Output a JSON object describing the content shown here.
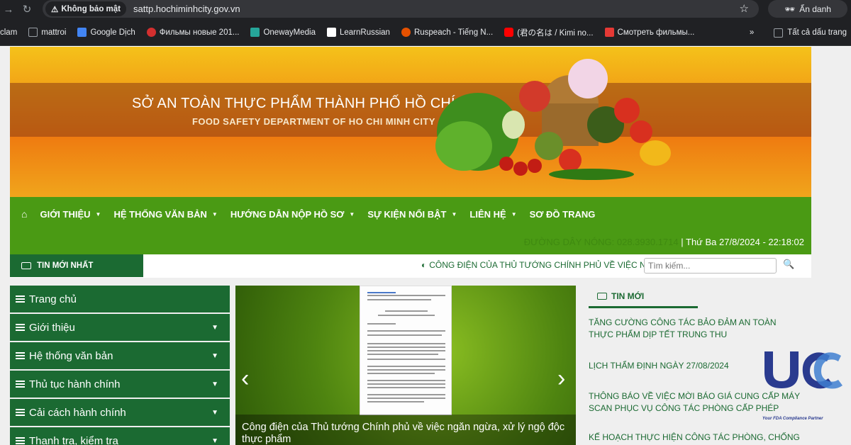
{
  "browser": {
    "security_label": "Không bảo mật",
    "url": "sattp.hochiminhcity.gov.vn",
    "incognito_label": "Ẩn danh"
  },
  "bookmarks": {
    "items": [
      {
        "label": "clam",
        "color": "#202124"
      },
      {
        "label": "mattroi",
        "color": "#9aa0a6"
      },
      {
        "label": "Google Dịch",
        "color": "#4285f4"
      },
      {
        "label": "Фильмы новые 201...",
        "color": "#d32f2f"
      },
      {
        "label": "OnewayMedia",
        "color": "#26a69a"
      },
      {
        "label": "LearnRussian",
        "color": "#ffffff"
      },
      {
        "label": "Ruspeach - Tiếng N...",
        "color": "#e65100"
      },
      {
        "label": "(君の名は / Kimi no...",
        "color": "#ff0000"
      },
      {
        "label": "Смотреть фильмы...",
        "color": "#e53935"
      }
    ],
    "overflow": "»",
    "all_label": "Tất cả dấu trang"
  },
  "banner": {
    "title_vi": "SỞ AN TOÀN THỰC PHẨM THÀNH PHỐ HỒ CHÍ MINH",
    "title_en": "FOOD SAFETY DEPARTMENT OF HO CHI MINH CITY"
  },
  "menu": {
    "items": [
      {
        "label": "GIỚI THIỆU",
        "caret": true
      },
      {
        "label": "HỆ THỐNG VĂN BẢN",
        "caret": true
      },
      {
        "label": "HƯỚNG DẪN NỘP HỒ SƠ",
        "caret": true
      },
      {
        "label": "SỰ KIỆN NỔI BẬT",
        "caret": true
      },
      {
        "label": "LIÊN HỆ",
        "caret": true
      },
      {
        "label": "SƠ ĐỒ TRANG",
        "caret": false
      }
    ],
    "hotline": "ĐƯỜNG DÂY NÓNG: 028.3930.1714",
    "datetime": "| Thứ Ba 27/8/2024 - 22:18:02"
  },
  "ticker": {
    "label": "TIN MỚI NHẤT",
    "headline": "CÔNG ĐIỆN CỦA THỦ TƯỚNG CHÍNH PHỦ VỀ VIỆC NGĂ",
    "search_placeholder": "Tìm kiếm..."
  },
  "sidebar": {
    "items": [
      {
        "label": "Trang chủ",
        "caret": false
      },
      {
        "label": "Giới thiệu",
        "caret": true
      },
      {
        "label": "Hệ thống văn bản",
        "caret": true
      },
      {
        "label": "Thủ tục hành chính",
        "caret": true
      },
      {
        "label": "Cải cách hành chính",
        "caret": true
      },
      {
        "label": "Thanh tra, kiểm tra",
        "caret": true
      }
    ]
  },
  "slider": {
    "caption": "Công điện của Thủ tướng Chính phủ về việc ngăn ngừa, xử lý ngộ độc thực phẩm"
  },
  "latest_news": {
    "title": "TIN MỚI",
    "items": [
      "TĂNG CƯỜNG CÔNG TÁC BẢO ĐẢM AN TOÀN THỰC PHẨM DỊP TẾT TRUNG THU",
      "LỊCH THẨM ĐỊNH NGÀY 27/08/2024",
      "THÔNG BÁO VỀ VIỆC MỜI BÁO GIÁ CUNG CẤP MÁY SCAN PHỤC VỤ CÔNG TÁC PHÒNG CẤP PHÉP",
      "KẾ HOẠCH THỰC HIỆN CÔNG TÁC PHÒNG, CHỐNG"
    ]
  },
  "watermark": {
    "tagline": "Your FDA Compliance Partner"
  }
}
